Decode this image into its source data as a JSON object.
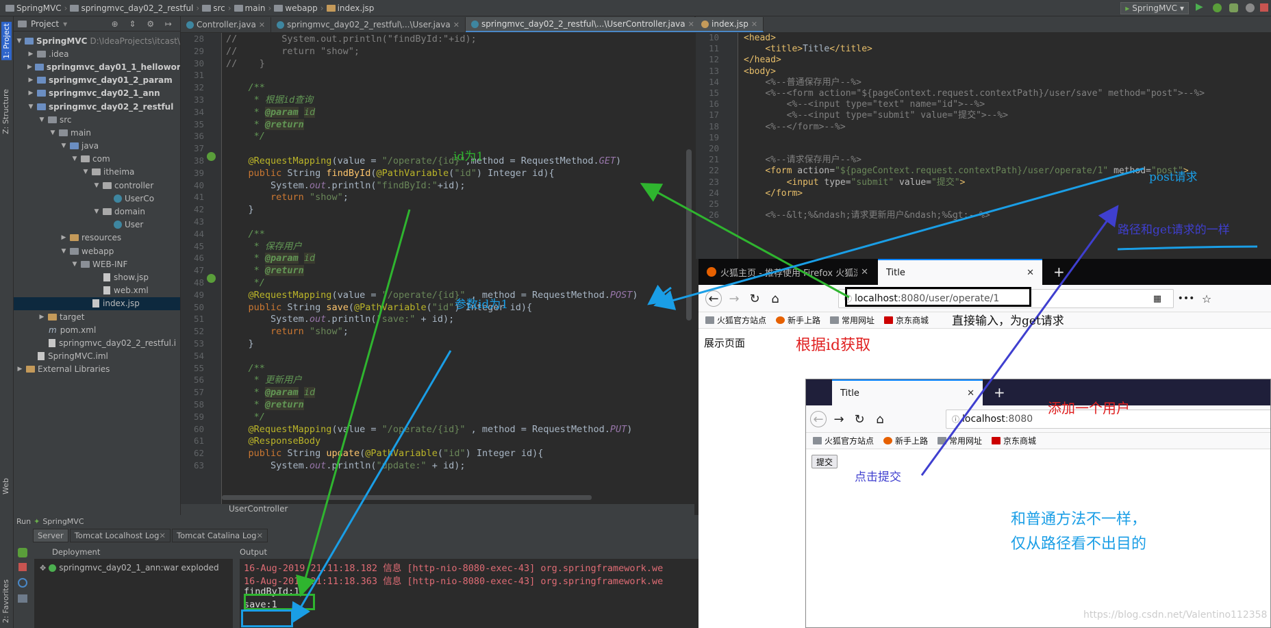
{
  "navbar": {
    "crumbs": [
      "SpringMVC",
      "springmvc_day02_2_restful",
      "src",
      "main",
      "webapp",
      "index.jsp"
    ],
    "run_config": "SpringMVC"
  },
  "tool_strip": {
    "project_tab": "1: Project",
    "structure_tab": "Z: Structure",
    "web_tab": "Web",
    "favorites_tab": "2: Favorites"
  },
  "project": {
    "header": "Project",
    "tree": [
      {
        "label": "SpringMVC",
        "detail": "D:\\IdeaProjects\\itcast\\",
        "indent": 0,
        "arrow": "▼",
        "icon": "mod",
        "bold": true
      },
      {
        "label": ".idea",
        "indent": 1,
        "arrow": "▶",
        "icon": "fold"
      },
      {
        "label": "springmvc_day01_1_helloworld",
        "indent": 1,
        "arrow": "▶",
        "icon": "mod",
        "bold": true
      },
      {
        "label": "springmvc_day01_2_param",
        "indent": 1,
        "arrow": "▶",
        "icon": "mod",
        "bold": true
      },
      {
        "label": "springmvc_day02_1_ann",
        "indent": 1,
        "arrow": "▶",
        "icon": "mod",
        "bold": true
      },
      {
        "label": "springmvc_day02_2_restful",
        "indent": 1,
        "arrow": "▼",
        "icon": "mod",
        "bold": true
      },
      {
        "label": "src",
        "indent": 2,
        "arrow": "▼",
        "icon": "fold"
      },
      {
        "label": "main",
        "indent": 3,
        "arrow": "▼",
        "icon": "fold"
      },
      {
        "label": "java",
        "indent": 4,
        "arrow": "▼",
        "icon": "src"
      },
      {
        "label": "com",
        "indent": 5,
        "arrow": "▼",
        "icon": "pkg"
      },
      {
        "label": "itheima",
        "indent": 6,
        "arrow": "▼",
        "icon": "pkg"
      },
      {
        "label": "controller",
        "indent": 7,
        "arrow": "▼",
        "icon": "pkg"
      },
      {
        "label": "UserCo",
        "indent": 8,
        "arrow": "",
        "icon": "java"
      },
      {
        "label": "domain",
        "indent": 7,
        "arrow": "▼",
        "icon": "pkg"
      },
      {
        "label": "User",
        "indent": 8,
        "arrow": "",
        "icon": "java"
      },
      {
        "label": "resources",
        "indent": 4,
        "arrow": "▶",
        "icon": "res"
      },
      {
        "label": "webapp",
        "indent": 4,
        "arrow": "▼",
        "icon": "fold"
      },
      {
        "label": "WEB-INF",
        "indent": 5,
        "arrow": "▼",
        "icon": "fold"
      },
      {
        "label": "show.jsp",
        "indent": 7,
        "arrow": "",
        "icon": "file"
      },
      {
        "label": "web.xml",
        "indent": 7,
        "arrow": "",
        "icon": "file"
      },
      {
        "label": "index.jsp",
        "indent": 6,
        "arrow": "",
        "icon": "file",
        "selected": true
      },
      {
        "label": "target",
        "indent": 2,
        "arrow": "▶",
        "icon": "res"
      },
      {
        "label": "pom.xml",
        "indent": 2,
        "arrow": "",
        "icon": "file",
        "prefix": "m"
      },
      {
        "label": "springmvc_day02_2_restful.i",
        "indent": 2,
        "arrow": "",
        "icon": "file"
      },
      {
        "label": "SpringMVC.iml",
        "indent": 1,
        "arrow": "",
        "icon": "file"
      },
      {
        "label": "External Libraries",
        "indent": 0,
        "arrow": "▶",
        "icon": "res"
      }
    ]
  },
  "editor1": {
    "tabs": [
      {
        "label": "Controller.java",
        "active": false
      },
      {
        "label": "springmvc_day02_2_restful\\...\\User.java",
        "active": false
      },
      {
        "label": "springmvc_day02_2_restful\\...\\UserController.java",
        "active": true
      }
    ],
    "breadcrumb": "UserController",
    "lines": [
      {
        "n": "28",
        "html": "<span class='gcm'>//        System.out.println(\"findById:\"+id);</span>"
      },
      {
        "n": "29",
        "html": "<span class='gcm'>//        return \"show\";</span>"
      },
      {
        "n": "30",
        "html": "<span class='gcm'>//    }</span>"
      },
      {
        "n": "31",
        "html": ""
      },
      {
        "n": "32",
        "html": "    <span class='cmt'>/**</span>"
      },
      {
        "n": "33",
        "html": "    <span class='cmt'> * 根据id查询</span>"
      },
      {
        "n": "34",
        "html": "    <span class='cmt'> * </span><span class='doctag'>@param</span> <span class='cmt' style='background:#3a3b2f'>id</span>"
      },
      {
        "n": "35",
        "html": "    <span class='cmt'> * </span><span class='doctag'>@return</span>"
      },
      {
        "n": "36",
        "html": "    <span class='cmt'> */</span>"
      },
      {
        "n": "37",
        "html": ""
      },
      {
        "n": "38",
        "html": "    <span class='ann'>@RequestMapping</span>(value = <span class='str'>\"/operate/{id}\"</span>,method = RequestMethod.<span class='ital'>GET</span>)"
      },
      {
        "n": "39",
        "html": "    <span class='kw'>public</span> String <span style='color:#ffc66d'>findById</span>(<span class='ann'>@PathVariable</span>(<span class='str'>\"id\"</span>) Integer id){"
      },
      {
        "n": "40",
        "html": "        System.<span class='ital'>out</span>.println(<span class='str'>\"findById:\"</span>+id);"
      },
      {
        "n": "41",
        "html": "        <span class='kw'>return</span> <span class='str'>\"show\"</span>;"
      },
      {
        "n": "42",
        "html": "    }"
      },
      {
        "n": "43",
        "html": ""
      },
      {
        "n": "44",
        "html": "    <span class='cmt'>/**</span>"
      },
      {
        "n": "45",
        "html": "    <span class='cmt'> * 保存用户</span>"
      },
      {
        "n": "46",
        "html": "    <span class='cmt'> * </span><span class='doctag'>@param</span> <span class='cmt' style='background:#3a3b2f'>id</span>"
      },
      {
        "n": "47",
        "html": "    <span class='cmt'> * </span><span class='doctag'>@return</span>"
      },
      {
        "n": "48",
        "html": "    <span class='cmt'> */</span>"
      },
      {
        "n": "49",
        "html": "    <span class='ann'>@RequestMapping</span>(value = <span class='str'>\"/operate/{id}\"</span> , method = RequestMethod.<span class='ital'>POST</span>)"
      },
      {
        "n": "50",
        "html": "    <span class='kw'>public</span> String <span style='color:#ffc66d'>save</span>(<span class='ann'>@PathVariable</span>(<span class='str'>\"id\"</span>) Integer id){"
      },
      {
        "n": "51",
        "html": "        System.<span class='ital'>out</span>.println(<span class='str'>\"save:\"</span> + id);"
      },
      {
        "n": "52",
        "html": "        <span class='kw'>return</span> <span class='str'>\"show\"</span>;"
      },
      {
        "n": "53",
        "html": "    }"
      },
      {
        "n": "54",
        "html": ""
      },
      {
        "n": "55",
        "html": "    <span class='cmt'>/**</span>"
      },
      {
        "n": "56",
        "html": "    <span class='cmt'> * 更新用户</span>"
      },
      {
        "n": "57",
        "html": "    <span class='cmt'> * </span><span class='doctag'>@param</span> <span class='cmt' style='background:#3a3b2f'>id</span>"
      },
      {
        "n": "58",
        "html": "    <span class='cmt'> * </span><span class='doctag'>@return</span>"
      },
      {
        "n": "59",
        "html": "    <span class='cmt'> */</span>"
      },
      {
        "n": "60",
        "html": "    <span class='ann'>@RequestMapping</span>(value = <span class='str'>\"/operate/{id}\"</span> , method = RequestMethod.<span class='ital'>PUT</span>)"
      },
      {
        "n": "61",
        "html": "    <span class='ann'>@ResponseBody</span>"
      },
      {
        "n": "62",
        "html": "    <span class='kw'>public</span> String <span style='color:#ffc66d'>update</span>(<span class='ann'>@PathVariable</span>(<span class='str'>\"id\"</span>) Integer id){"
      },
      {
        "n": "63",
        "html": "        System.<span class='ital'>out</span>.println(<span class='str'>\"update:\"</span> + id);"
      }
    ]
  },
  "editor2": {
    "tabs": [
      {
        "label": "index.jsp",
        "active": true
      }
    ],
    "lines": [
      {
        "n": "10",
        "html": "<span class='tag'>&lt;head&gt;</span>"
      },
      {
        "n": "11",
        "html": "    <span class='tag'>&lt;title&gt;</span>Title<span class='tag'>&lt;/title&gt;</span>"
      },
      {
        "n": "12",
        "html": "<span class='tag'>&lt;/head&gt;</span>"
      },
      {
        "n": "13",
        "html": "<span class='tag'>&lt;body&gt;</span>"
      },
      {
        "n": "14",
        "html": "    <span class='gcm'>&lt;%--普通保存用户--%&gt;</span>"
      },
      {
        "n": "15",
        "html": "    <span class='gcm'>&lt;%--&lt;form action=\"${pageContext.request.contextPath}/user/save\" method=\"post\"&gt;--%&gt;</span>"
      },
      {
        "n": "16",
        "html": "        <span class='gcm'>&lt;%--&lt;input type=\"text\" name=\"id\"&gt;--%&gt;</span>"
      },
      {
        "n": "17",
        "html": "        <span class='gcm'>&lt;%--&lt;input type=\"submit\" value=\"提交\"&gt;--%&gt;</span>"
      },
      {
        "n": "18",
        "html": "    <span class='gcm'>&lt;%--&lt;/form&gt;--%&gt;</span>"
      },
      {
        "n": "19",
        "html": ""
      },
      {
        "n": "20",
        "html": ""
      },
      {
        "n": "21",
        "html": "    <span class='gcm'>&lt;%--请求保存用户--%&gt;</span>"
      },
      {
        "n": "22",
        "html": "    <span class='tag'>&lt;form </span><span class='attr'>action=</span><span class='str'>\"${pageContext.request.contextPath}/user/operate/1\"</span> <span class='attr'>method=</span><span class='str'>\"post\"</span><span class='tag'>&gt;</span>"
      },
      {
        "n": "23",
        "html": "        <span class='tag'>&lt;input </span><span class='attr'>type=</span><span class='str'>\"submit\"</span> <span class='attr'>value=</span><span class='str'>\"提交\"</span><span class='tag'>&gt;</span>"
      },
      {
        "n": "24",
        "html": "    <span class='tag'>&lt;/form&gt;</span>"
      },
      {
        "n": "25",
        "html": ""
      },
      {
        "n": "26",
        "html": "    <span class='gcm'>&lt;%--&amp;lt;%&amp;ndash;请求更新用户&amp;ndash;%&amp;gt;--%&gt;</span>"
      }
    ]
  },
  "run": {
    "header": "Run",
    "config": "SpringMVC",
    "tabs": [
      "Server",
      "Tomcat Localhost Log",
      "Tomcat Catalina Log"
    ],
    "deployment_label": "Deployment",
    "output_label": "Output",
    "deployment_item": "springmvc_day02_1_ann:war exploded",
    "output_lines": [
      "16-Aug-2019 21:11:18.182 信息 [http-nio-8080-exec-43] org.springframework.we",
      "16-Aug-2019 21:11:18.363 信息 [http-nio-8080-exec-43] org.springframework.we"
    ],
    "find_line": "findById:1",
    "save_line": "save:1"
  },
  "browser1": {
    "tab_inactive": "火狐主页 - 推荐使用 Firefox 火狐浏",
    "tab_active": "Title",
    "url_host": "localhost",
    "url_path": ":8080/user/operate/1",
    "bookmarks": [
      "火狐官方站点",
      "新手上路",
      "常用网址",
      "京东商城"
    ],
    "body_text": "展示页面"
  },
  "browser2": {
    "tab_active": "Title",
    "url_host": "localhost",
    "url_path": ":8080",
    "bookmarks": [
      "火狐官方站点",
      "新手上路",
      "常用网址",
      "京东商城"
    ],
    "submit_button": "提交"
  },
  "annotations": {
    "id_is_1": "id为1",
    "param_id_1": "参数id为1",
    "post_request": "post请求",
    "same_path": "路径和get请求的一样",
    "direct_input": "直接输入，为get请求",
    "get_by_id": "根据id获取",
    "add_user": "添加一个用户",
    "click_submit": "点击提交",
    "diff_line1": "和普通方法不一样，",
    "diff_line2": "仅从路径看不出目的",
    "watermark": "https://blog.csdn.net/Valentino112358"
  },
  "colors": {
    "green_arrow": "#2fb52f",
    "blue_arrow": "#1a9ee6",
    "indigo_arrow": "#3f3fcf",
    "red_text": "#e02020"
  }
}
